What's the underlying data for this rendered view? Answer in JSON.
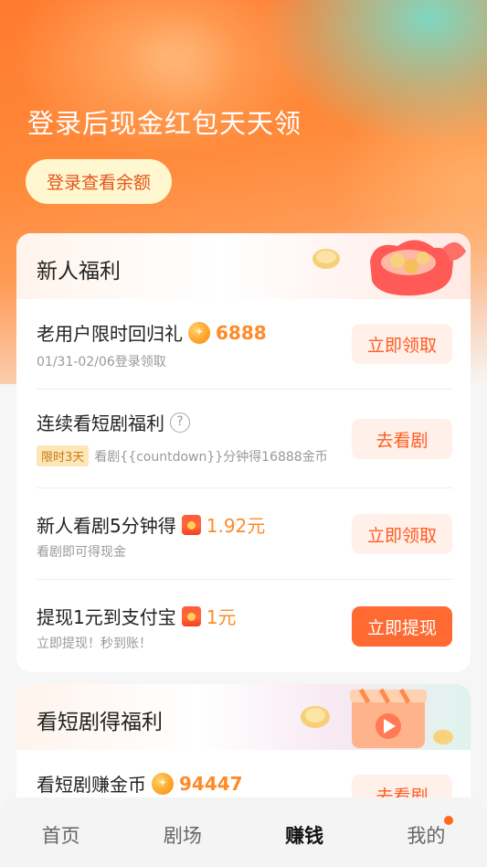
{
  "hero": {
    "title": "登录后现金红包天天领",
    "login_label": "登录查看余额"
  },
  "newbie": {
    "title": "新人福利",
    "items": [
      {
        "title": "老用户限时回归礼",
        "amount": "6888",
        "amount_icon": "coin-icon",
        "sub": "01/31-02/06登录领取",
        "button": "立即领取"
      },
      {
        "title": "连续看短剧福利",
        "badge": "限时3天",
        "sub": "看剧{{countdown}}分钟得16888金币",
        "button": "去看剧"
      },
      {
        "title": "新人看剧5分钟得",
        "amount": "1.92元",
        "amount_icon": "red-envelope-icon",
        "sub": "看剧即可得现金",
        "button": "立即领取"
      },
      {
        "title": "提现1元到支付宝",
        "amount": "1元",
        "amount_icon": "red-envelope-icon",
        "sub": "立即提现！秒到账！",
        "button": "立即提现"
      }
    ]
  },
  "drama": {
    "title": "看短剧得福利",
    "items": [
      {
        "title": "看短剧赚金币",
        "amount": "94447",
        "amount_icon": "coin-icon",
        "button": "去看剧"
      }
    ]
  },
  "tabbar": {
    "tabs": [
      {
        "label": "首页"
      },
      {
        "label": "剧场"
      },
      {
        "label": "赚钱"
      },
      {
        "label": "我的"
      }
    ]
  },
  "colors": {
    "accent": "#ff6a32",
    "amount": "#ff8a28",
    "login_bg": "#fff7cf"
  }
}
